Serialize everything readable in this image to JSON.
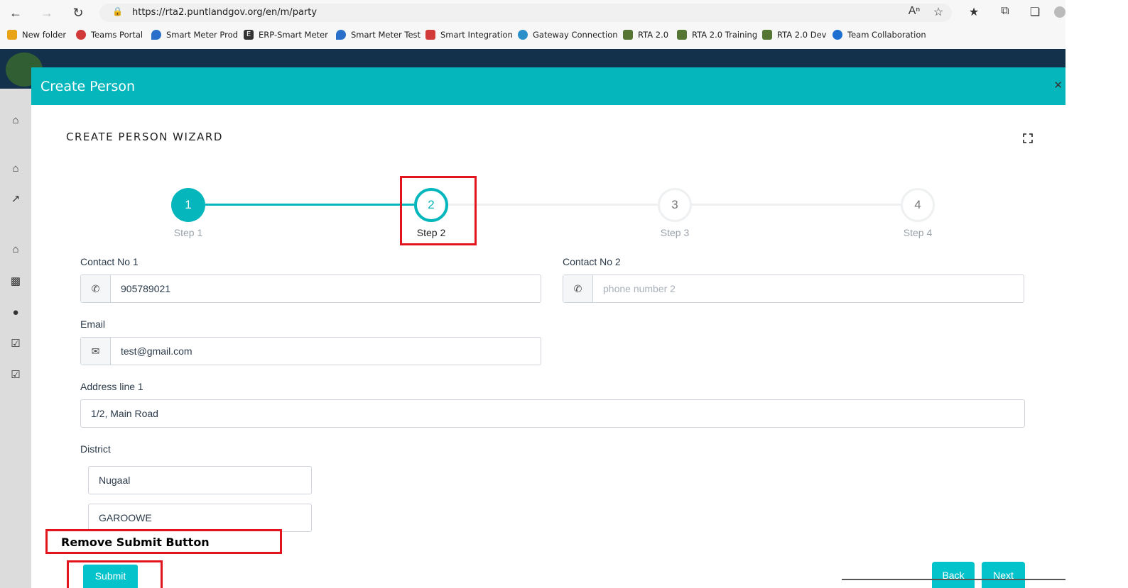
{
  "browser": {
    "url": "https://rta2.puntlandgov.org/en/m/party",
    "bookmarks": [
      {
        "label": "New folder",
        "color": "#e8a317",
        "glyph": ""
      },
      {
        "label": "Teams Portal",
        "color": "#d23a3a",
        "glyph": ""
      },
      {
        "label": "Smart Meter Prod",
        "color": "#2a6fc9",
        "glyph": ""
      },
      {
        "label": "ERP-Smart Meter",
        "color": "#333333",
        "glyph": "E"
      },
      {
        "label": "Smart Meter Test",
        "color": "#2a6fc9",
        "glyph": ""
      },
      {
        "label": "Smart Integration",
        "color": "#d23a3a",
        "glyph": ""
      },
      {
        "label": "Gateway Connection",
        "color": "#2a8fc9",
        "glyph": ""
      },
      {
        "label": "RTA 2.0",
        "color": "#557733",
        "glyph": ""
      },
      {
        "label": "RTA 2.0 Training",
        "color": "#557733",
        "glyph": ""
      },
      {
        "label": "RTA 2.0 Dev",
        "color": "#557733",
        "glyph": ""
      },
      {
        "label": "Team Collaboration",
        "color": "#1f6fd1",
        "glyph": ""
      }
    ]
  },
  "modal": {
    "title": "Create Person",
    "wizard_title": "CREATE PERSON WIZARD",
    "close_glyph": "✕"
  },
  "steps": [
    {
      "number": "1",
      "label": "Step 1",
      "state": "done"
    },
    {
      "number": "2",
      "label": "Step 2",
      "state": "active"
    },
    {
      "number": "3",
      "label": "Step 3",
      "state": "todo"
    },
    {
      "number": "4",
      "label": "Step 4",
      "state": "todo"
    }
  ],
  "form": {
    "contact1": {
      "label": "Contact No 1",
      "value": "905789021",
      "placeholder": ""
    },
    "contact2": {
      "label": "Contact No 2",
      "value": "",
      "placeholder": "phone number 2"
    },
    "email": {
      "label": "Email",
      "value": "test@gmail.com",
      "placeholder": ""
    },
    "address": {
      "label": "Address line 1",
      "value": "1/2, Main Road",
      "placeholder": ""
    },
    "district": {
      "label": "District",
      "region_value": "Nugaal",
      "city_value": "GAROOWE"
    }
  },
  "buttons": {
    "submit": "Submit",
    "back": "Back",
    "next": "Next"
  },
  "annotation": {
    "note": "Remove Submit Button",
    "color": "#e2141d"
  },
  "colors": {
    "accent": "#05b7bd",
    "button": "#05c3cb",
    "app_header": "#13314a"
  }
}
